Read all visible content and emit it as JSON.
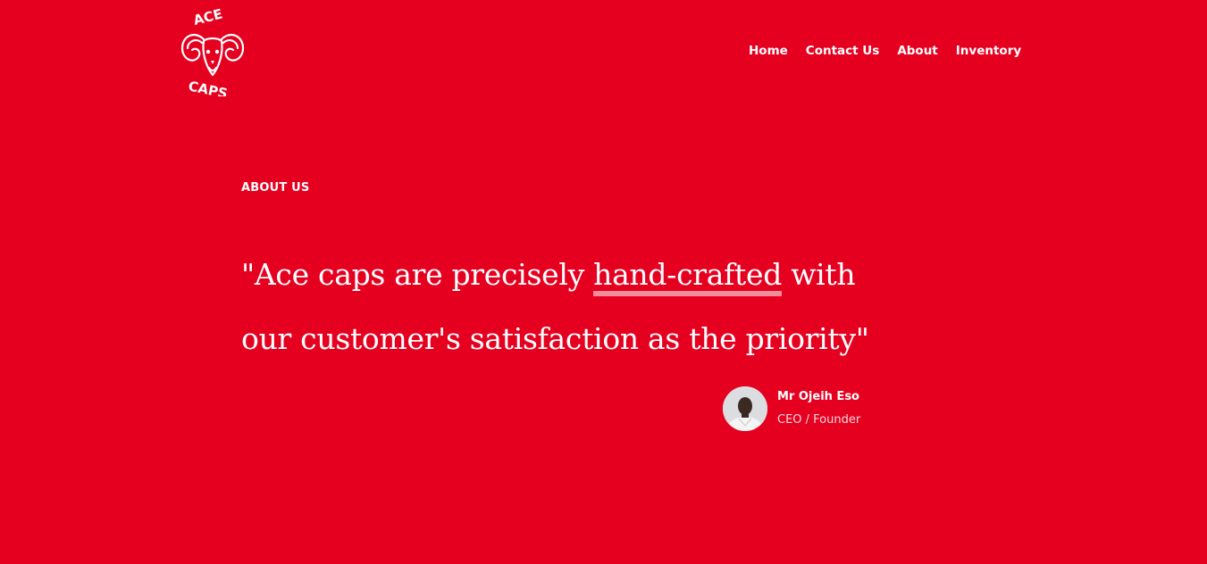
{
  "brand": {
    "logo_text_top": "ACE",
    "logo_text_bottom": "CAPS",
    "logo_icon": "ram-head-icon",
    "background_color": "#e50020"
  },
  "nav": {
    "items": [
      {
        "label": "Home"
      },
      {
        "label": "Contact Us"
      },
      {
        "label": "About"
      },
      {
        "label": "Inventory"
      }
    ]
  },
  "about": {
    "section_label": "ABOUT US",
    "quote_before": "\"Ace caps are precisely ",
    "quote_highlight": "hand-crafted",
    "quote_after": " with our customer's satisfaction as the priority\""
  },
  "author": {
    "name": "Mr Ojeih Eso",
    "role": "CEO / Founder",
    "avatar_icon": "person-avatar"
  }
}
